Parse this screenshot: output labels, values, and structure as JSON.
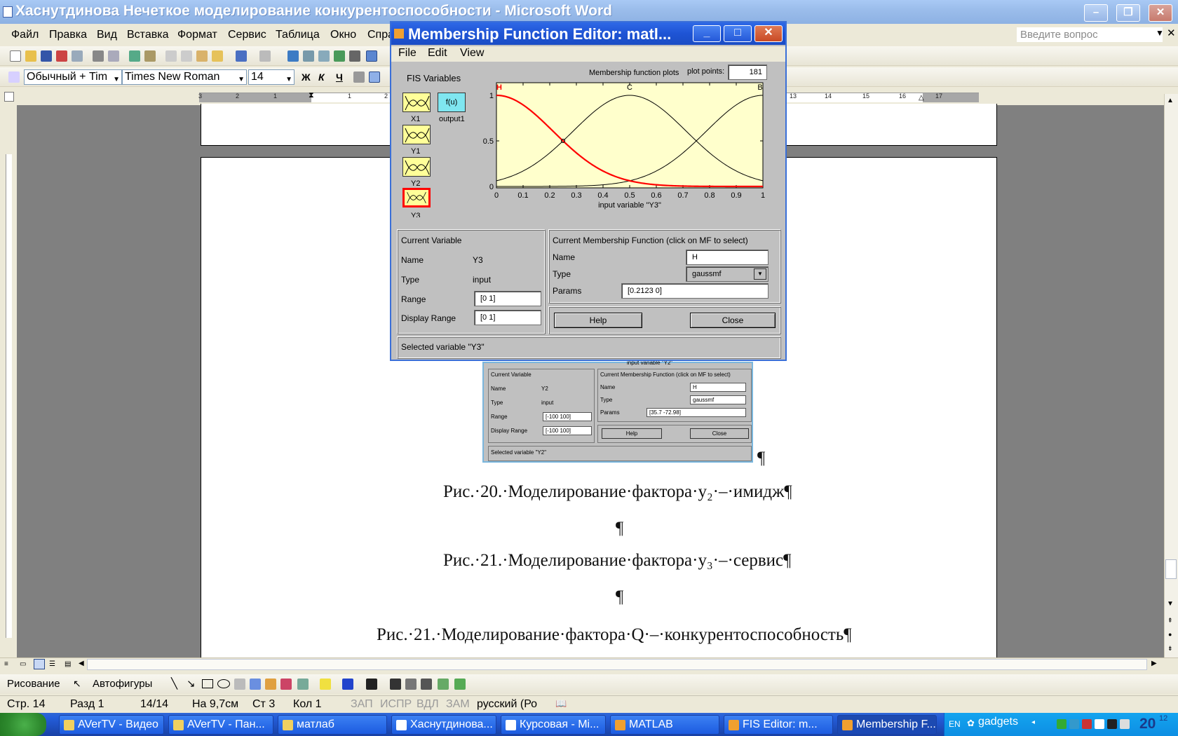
{
  "word": {
    "title": "Хаснутдинова Нечеткое моделирование конкурентоспособности - Microsoft Word",
    "menu": [
      "Файл",
      "Правка",
      "Вид",
      "Вставка",
      "Формат",
      "Сервис",
      "Таблица",
      "Окно",
      "Спра"
    ],
    "ask_placeholder": "Введите вопрос",
    "style": "Обычный + Tim",
    "font": "Times New Roman",
    "size": "14",
    "bold": "Ж",
    "italic": "К",
    "underline": "Ч",
    "ruler_numbers": [
      "3",
      "2",
      "1",
      "1",
      "2",
      "13",
      "14",
      "15",
      "16",
      "17"
    ],
    "paragraphs": [
      "¶",
      "Рис.·20.·Моделирование·фактора·y₂·–·имидж¶",
      "¶",
      "Рис.·21.·Моделирование·фактора·y₃·–·сервис¶",
      "¶",
      "Рис.·21.·Моделирование·фактора·Q·–·конкурентоспособность¶"
    ],
    "drawing_label": "Рисование",
    "autoshapes_label": "Автофигуры",
    "status": {
      "page": "Стр. 14",
      "section": "Разд 1",
      "pages": "14/14",
      "at": "На 9,7см",
      "line": "Ст 3",
      "col": "Кол 1",
      "rec": "ЗАП",
      "trk": "ИСПР",
      "ext": "ВДЛ",
      "ovr": "ЗАМ",
      "lang": "русский (Ро"
    }
  },
  "taskbar": {
    "items": [
      "AVerTV - Видео",
      "AVerTV - Пан...",
      "матлаб",
      "Хаснутдинова...",
      "Курсовая - Mi...",
      "MATLAB",
      "FIS Editor: m...",
      "Membership F..."
    ],
    "tray_lang": "EN",
    "gadgets": "gadgets",
    "clock": "20",
    "clock_small": "12"
  },
  "mf_editor": {
    "title": "Membership Function Editor: matl...",
    "menu": [
      "File",
      "Edit",
      "View"
    ],
    "fis_variables_label": "FIS Variables",
    "variables": [
      "X1",
      "Y1",
      "Y2",
      "Y3"
    ],
    "output_icon": "f(u)",
    "output_label": "output1",
    "plots_label": "Membership function plots",
    "plot_points_label": "plot points:",
    "plot_points": "181",
    "xlabel": "input variable \"Y3\"",
    "current_variable": {
      "header": "Current Variable",
      "name_label": "Name",
      "name": "Y3",
      "type_label": "Type",
      "type": "input",
      "range_label": "Range",
      "range": "[0 1]",
      "display_range_label": "Display Range",
      "display_range": "[0 1]"
    },
    "current_mf": {
      "header": "Current Membership Function (click on MF to select)",
      "name_label": "Name",
      "name": "H",
      "type_label": "Type",
      "type": "gaussmf",
      "params_label": "Params",
      "params": "[0.2123 0]"
    },
    "help_label": "Help",
    "close_label": "Close",
    "status": "Selected variable \"Y3\""
  },
  "bg_editor": {
    "xlabel": "input variable \"Y2\"",
    "cv_header": "Current Variable",
    "name_label": "Name",
    "name": "Y2",
    "type_label": "Type",
    "type": "input",
    "range_label": "Range",
    "range": "[-100 100]",
    "display_range_label": "Display Range",
    "display_range": "[-100 100]",
    "mf_header": "Current Membership Function (click on MF to select)",
    "mf_name_label": "Name",
    "mf_name": "H",
    "mf_type_label": "Type",
    "mf_type": "gaussmf",
    "mf_params_label": "Params",
    "mf_params": "[35.7 -72.98]",
    "help_label": "Help",
    "close_label": "Close",
    "status": "Selected variable \"Y2\""
  },
  "chart_data": {
    "type": "line",
    "xlabel": "input variable \"Y3\"",
    "xlim": [
      0,
      1
    ],
    "ylim": [
      0,
      1
    ],
    "x_ticks": [
      "0",
      "0.1",
      "0.2",
      "0.3",
      "0.4",
      "0.5",
      "0.6",
      "0.7",
      "0.8",
      "0.9",
      "1"
    ],
    "y_ticks": [
      "0",
      "0.5",
      "1"
    ],
    "series": [
      {
        "name": "H",
        "mf": "gaussmf",
        "sigma": 0.2123,
        "center": 0,
        "color": "#ff0000",
        "selected": true
      },
      {
        "name": "C",
        "mf": "gaussmf",
        "sigma": 0.2123,
        "center": 0.5,
        "color": "#000000"
      },
      {
        "name": "B",
        "mf": "gaussmf",
        "sigma": 0.2123,
        "center": 1,
        "color": "#000000"
      }
    ],
    "background": "#ffffcc"
  }
}
